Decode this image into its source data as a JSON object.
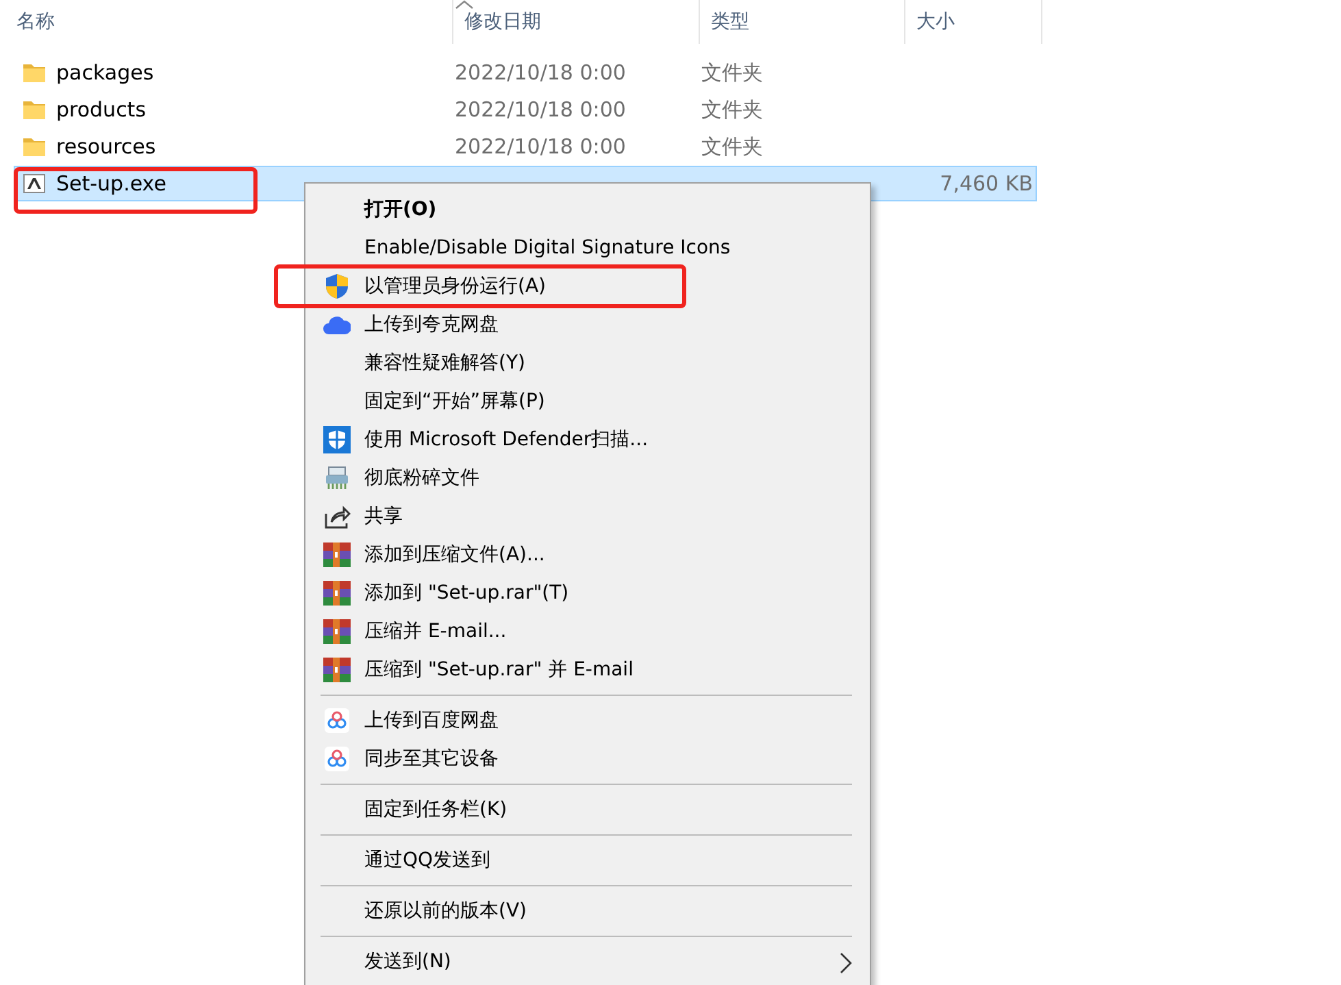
{
  "columns": [
    {
      "label": "名称"
    },
    {
      "label": "修改日期"
    },
    {
      "label": "类型"
    },
    {
      "label": "大小"
    }
  ],
  "files": [
    {
      "kind": "folder",
      "name": "packages",
      "date": "2022/10/18 0:00",
      "type": "文件夹",
      "selected": false,
      "marked": false
    },
    {
      "kind": "folder",
      "name": "products",
      "date": "2022/10/18 0:00",
      "type": "文件夹",
      "selected": false,
      "marked": false
    },
    {
      "kind": "folder",
      "name": "resources",
      "date": "2022/10/18 0:00",
      "type": "文件夹",
      "selected": false,
      "marked": false
    },
    {
      "kind": "app",
      "name": "Set-up.exe",
      "size": "7,460 KB",
      "selected": true,
      "marked": true
    }
  ],
  "context_menu": {
    "sections": [
      {
        "items": [
          {
            "label": "打开(O)",
            "kind": "plain",
            "default": true,
            "marked": false,
            "submenu": false
          },
          {
            "label": "Enable/Disable Digital Signature Icons",
            "kind": "plain",
            "default": false,
            "marked": false,
            "submenu": false
          },
          {
            "label": "以管理员身份运行(A)",
            "kind": "shield",
            "default": false,
            "marked": true,
            "submenu": false
          },
          {
            "label": "上传到夸克网盘",
            "kind": "cloud",
            "default": false,
            "marked": false,
            "submenu": false
          },
          {
            "label": "兼容性疑难解答(Y)",
            "kind": "plain",
            "default": false,
            "marked": false,
            "submenu": false
          },
          {
            "label": "固定到“开始”屏幕(P)",
            "kind": "plain",
            "default": false,
            "marked": false,
            "submenu": false
          },
          {
            "label": "使用 Microsoft Defender扫描...",
            "kind": "defender",
            "default": false,
            "marked": false,
            "submenu": false
          },
          {
            "label": "彻底粉碎文件",
            "kind": "shredder",
            "default": false,
            "marked": false,
            "submenu": false
          },
          {
            "label": "共享",
            "kind": "share",
            "default": false,
            "marked": false,
            "submenu": false
          },
          {
            "label": "添加到压缩文件(A)...",
            "kind": "archive",
            "default": false,
            "marked": false,
            "submenu": false
          },
          {
            "label": "添加到 \"Set-up.rar\"(T)",
            "kind": "archive",
            "default": false,
            "marked": false,
            "submenu": false
          },
          {
            "label": "压缩并 E-mail...",
            "kind": "archive",
            "default": false,
            "marked": false,
            "submenu": false
          },
          {
            "label": "压缩到 \"Set-up.rar\" 并 E-mail",
            "kind": "archive",
            "default": false,
            "marked": false,
            "submenu": false
          }
        ]
      },
      {
        "items": [
          {
            "label": "上传到百度网盘",
            "kind": "baidu",
            "default": false,
            "marked": false,
            "submenu": false
          },
          {
            "label": "同步至其它设备",
            "kind": "baidu",
            "default": false,
            "marked": false,
            "submenu": false
          }
        ]
      },
      {
        "items": [
          {
            "label": "固定到任务栏(K)",
            "kind": "plain",
            "default": false,
            "marked": false,
            "submenu": false
          }
        ]
      },
      {
        "items": [
          {
            "label": "通过QQ发送到",
            "kind": "plain",
            "default": false,
            "marked": false,
            "submenu": false
          }
        ]
      },
      {
        "items": [
          {
            "label": "还原以前的版本(V)",
            "kind": "plain",
            "default": false,
            "marked": false,
            "submenu": false
          }
        ]
      },
      {
        "items": [
          {
            "label": "发送到(N)",
            "kind": "plain",
            "default": false,
            "marked": false,
            "submenu": true
          }
        ]
      }
    ]
  }
}
